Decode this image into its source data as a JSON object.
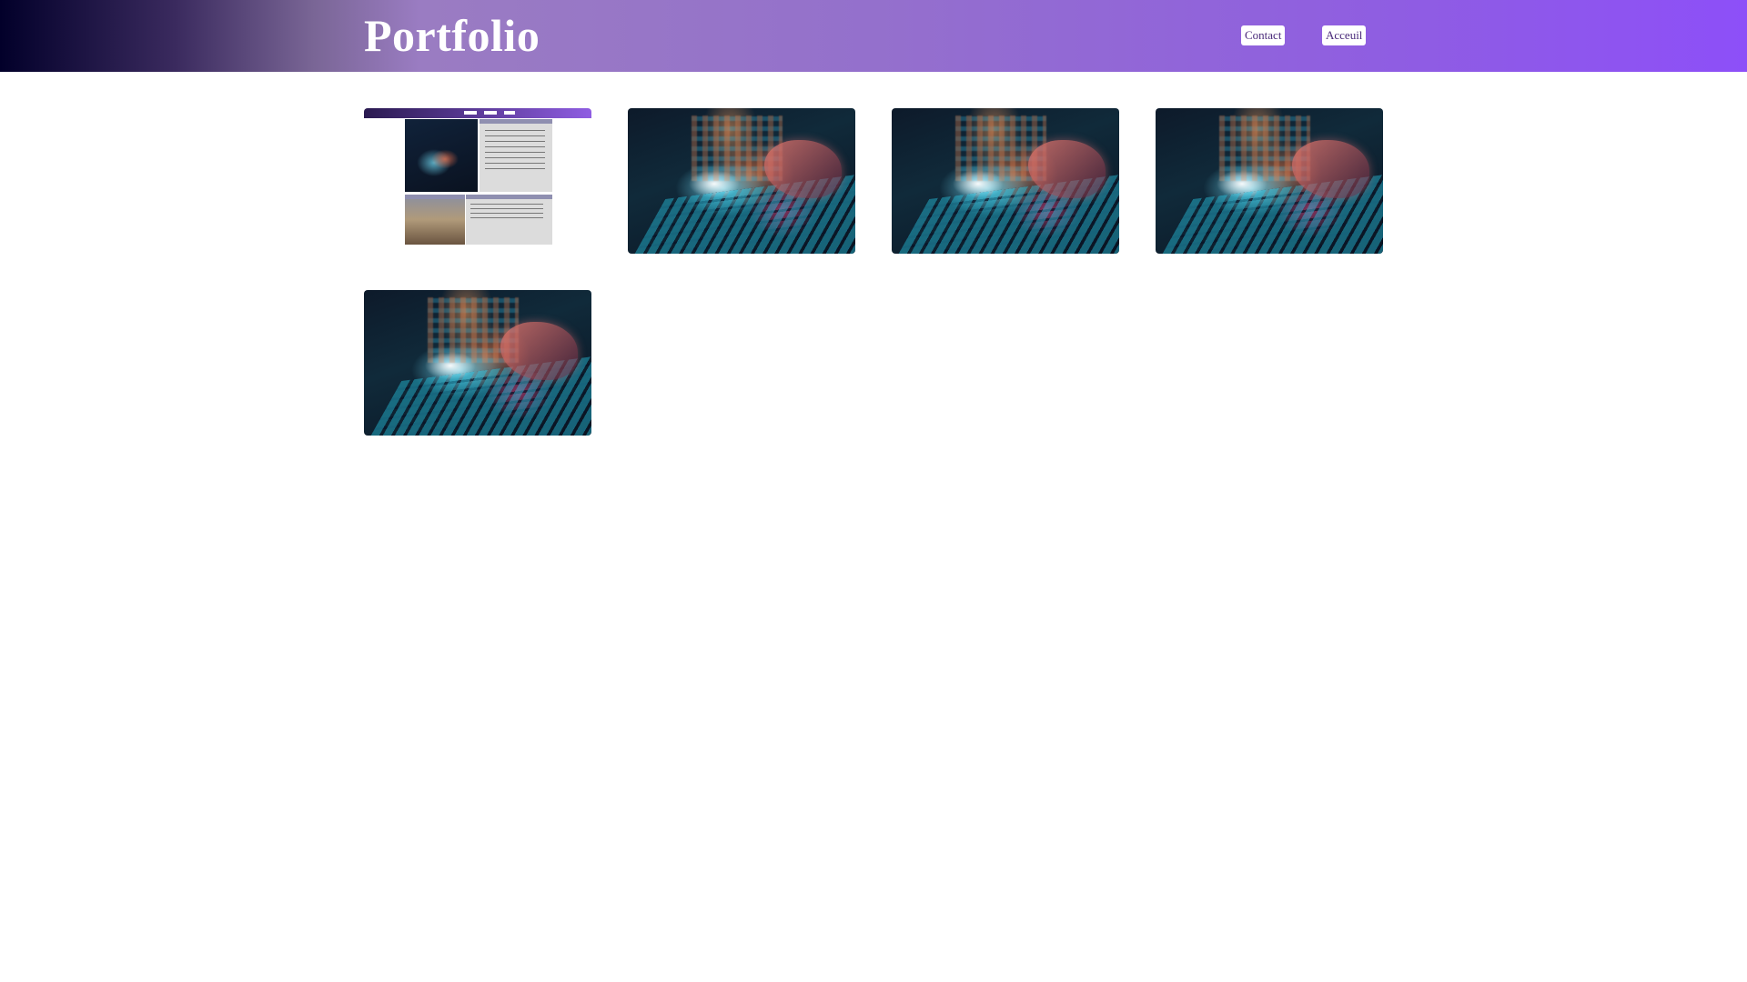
{
  "header": {
    "title": "Portfolio",
    "nav": [
      {
        "label": "Contact"
      },
      {
        "label": "Acceuil"
      }
    ]
  },
  "gallery": {
    "items": [
      {
        "type": "website-screenshot"
      },
      {
        "type": "digital-keyboard-image"
      },
      {
        "type": "digital-keyboard-image"
      },
      {
        "type": "digital-keyboard-image"
      },
      {
        "type": "digital-keyboard-image"
      }
    ]
  },
  "colors": {
    "header_gradient_start": "#02002a",
    "header_gradient_end": "#8d4ff8",
    "nav_text": "#4a2a7a"
  }
}
